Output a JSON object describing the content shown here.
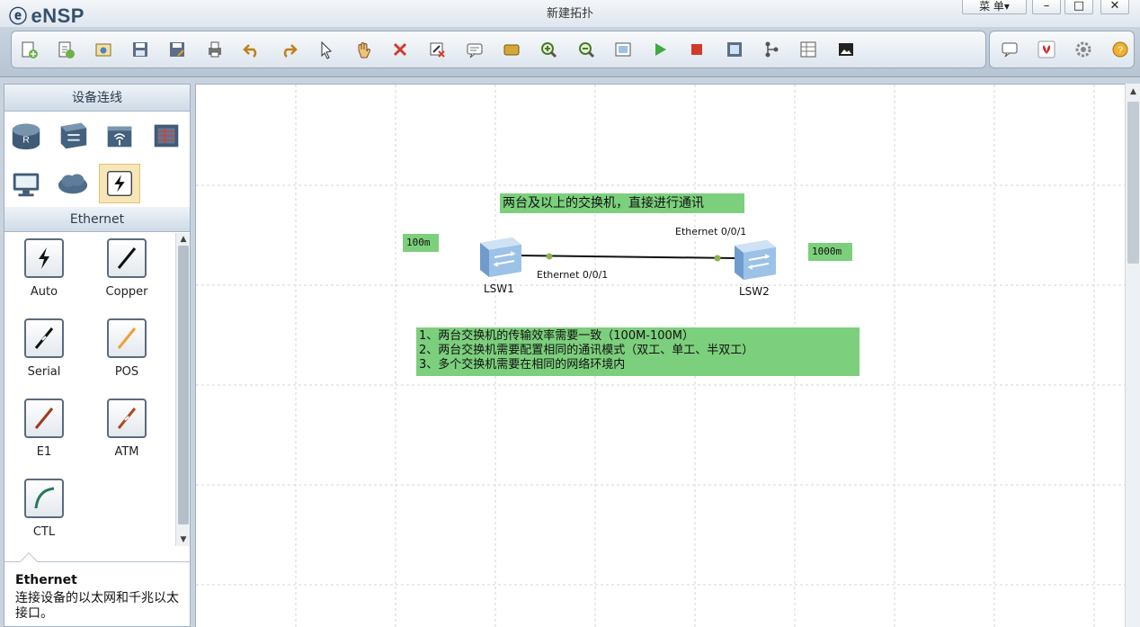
{
  "app": {
    "logo_text": "eNSP",
    "window_title": "新建拓扑",
    "menu_label": "菜 单▾",
    "minimize": "–",
    "maximize": "□",
    "close": "✕"
  },
  "toolbar": {
    "main_icons": [
      "new-topology-icon",
      "new-example-icon",
      "open-icon",
      "save-icon",
      "save-as-icon",
      "print-icon",
      "undo-icon",
      "redo-icon",
      "select-cursor-icon",
      "pan-hand-icon",
      "delete-icon",
      "delete-link-icon",
      "text-note-icon",
      "rectangle-icon",
      "zoom-in-icon",
      "zoom-out-icon",
      "fit-view-icon",
      "start-device-icon",
      "stop-device-icon",
      "capture-icon",
      "topology-icon",
      "grid-icon",
      "screenshot-icon"
    ],
    "right_icons": [
      "chat-icon",
      "huawei-icon",
      "settings-gear-icon",
      "help-icon"
    ]
  },
  "left_panel": {
    "devices_header": "设备连线",
    "device_categories": [
      "router-icon",
      "switch-icon",
      "wireless-icon",
      "firewall-icon",
      "pc-icon",
      "cloud-icon",
      "connection-icon"
    ],
    "cable_header": "Ethernet",
    "cables": [
      {
        "name": "Auto"
      },
      {
        "name": "Copper"
      },
      {
        "name": "Serial"
      },
      {
        "name": "POS"
      },
      {
        "name": "E1"
      },
      {
        "name": "ATM"
      },
      {
        "name": "CTL"
      }
    ],
    "description": {
      "title": "Ethernet",
      "text": "连接设备的以太网和千兆以太接口。"
    }
  },
  "canvas": {
    "heading_note": "两台及以上的交换机，直接进行通讯",
    "speed_left": "100m",
    "speed_right": "1000m",
    "devices": [
      {
        "name": "LSW1"
      },
      {
        "name": "LSW2"
      }
    ],
    "link": {
      "port_a": "Ethernet 0/0/1",
      "port_b": "Ethernet 0/0/1"
    },
    "requirements": [
      "1、两台交换机的传输效率需要一致（100M-100M）",
      "2、两台交换机需要配置相同的通讯模式（双工、单工、半双工）",
      "3、多个交换机需要在相同的网络环境内"
    ]
  },
  "colors": {
    "note_green": "#7ccf7c",
    "link_dot": "#8ab34a"
  }
}
